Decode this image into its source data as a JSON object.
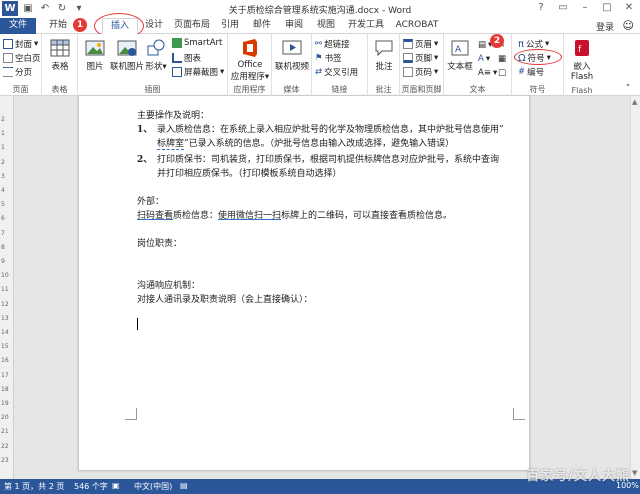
{
  "window": {
    "title": "关于质检综合管理系统实施沟通.docx - Word",
    "login": "登录"
  },
  "tabs": [
    {
      "label": "文件"
    },
    {
      "label": "开始"
    },
    {
      "label": "设计"
    },
    {
      "label": "页面布局"
    },
    {
      "label": "引用"
    },
    {
      "label": "邮件"
    },
    {
      "label": "审阅"
    },
    {
      "label": "视图"
    },
    {
      "label": "开发工具"
    },
    {
      "label": "ACROBAT"
    }
  ],
  "active_tab": {
    "label": "插入"
  },
  "callouts": {
    "one": "1",
    "two": "2"
  },
  "ribbon": {
    "pages": {
      "cover": "封面",
      "blank": "空白页",
      "break": "分页",
      "label": "页面"
    },
    "tables": {
      "table": "表格",
      "label": "表格"
    },
    "illustrations": {
      "picture": "图片",
      "online_picture": "联机图片",
      "shapes": "形状",
      "smartart": "SmartArt",
      "chart": "图表",
      "screenshot": "屏幕截图",
      "label": "插图"
    },
    "apps": {
      "office": "Office",
      "office2": "应用程序",
      "label": "应用程序"
    },
    "media": {
      "video": "联机视频",
      "label": "媒体"
    },
    "links": {
      "hyperlink": "超链接",
      "bookmark": "书签",
      "crossref": "交叉引用",
      "label": "链接"
    },
    "comments": {
      "comment": "批注",
      "label": "批注"
    },
    "header_footer": {
      "header": "页眉",
      "footer": "页脚",
      "page_number": "页码",
      "label": "页眉和页脚"
    },
    "text": {
      "textbox": "文本框",
      "label": "文本"
    },
    "symbols": {
      "equation": "公式",
      "symbol": "符号",
      "number": "编号",
      "label": "符号"
    },
    "flash": {
      "embed": "嵌入",
      "flash": "Flash",
      "label": "Flash"
    }
  },
  "document": {
    "lines": {
      "l1": "主要操作及说明：",
      "l2_num": "1、",
      "l2": "录入质检信息：在系统上录入相应炉批号的化学及物理质检信息，其中炉批号信息使用",
      "l2_quote": "”",
      "l3a": "标牌室",
      "l3b": "”已录入系统的信息。（炉批号信息由输入改成选择，避免输入错误）",
      "l4_num": "2、",
      "l4": "打印质保书：司机装货，打印质保书，根据司机提供标牌信息对应炉批号，系统中查询",
      "l5": "并打印相应质保书。（打印模板系统自动选择）",
      "l6": "外部：",
      "l7a": "扫码查看",
      "l7b": "质检信息：",
      "l7c": "使用微信扫一扫",
      "l7d": "标牌上的二维码，可以直接查看质检信息。",
      "l8": "岗位职责：",
      "l9": "沟通响应机制：",
      "l10": "对接人通讯录及职责说明（会上直接确认）："
    },
    "ruler_numbers": [
      "2",
      "1",
      "1",
      "2",
      "3",
      "4",
      "5",
      "6",
      "7",
      "8",
      "9",
      "10",
      "11",
      "12",
      "13",
      "14",
      "15",
      "16",
      "17",
      "18",
      "19",
      "20",
      "21",
      "22",
      "23"
    ]
  },
  "status": {
    "page": "第 1 页，共 2 页",
    "words": "546 个字",
    "lang": "中文(中国)",
    "zoom": "100%"
  },
  "watermark": "百家号/文人大熊"
}
